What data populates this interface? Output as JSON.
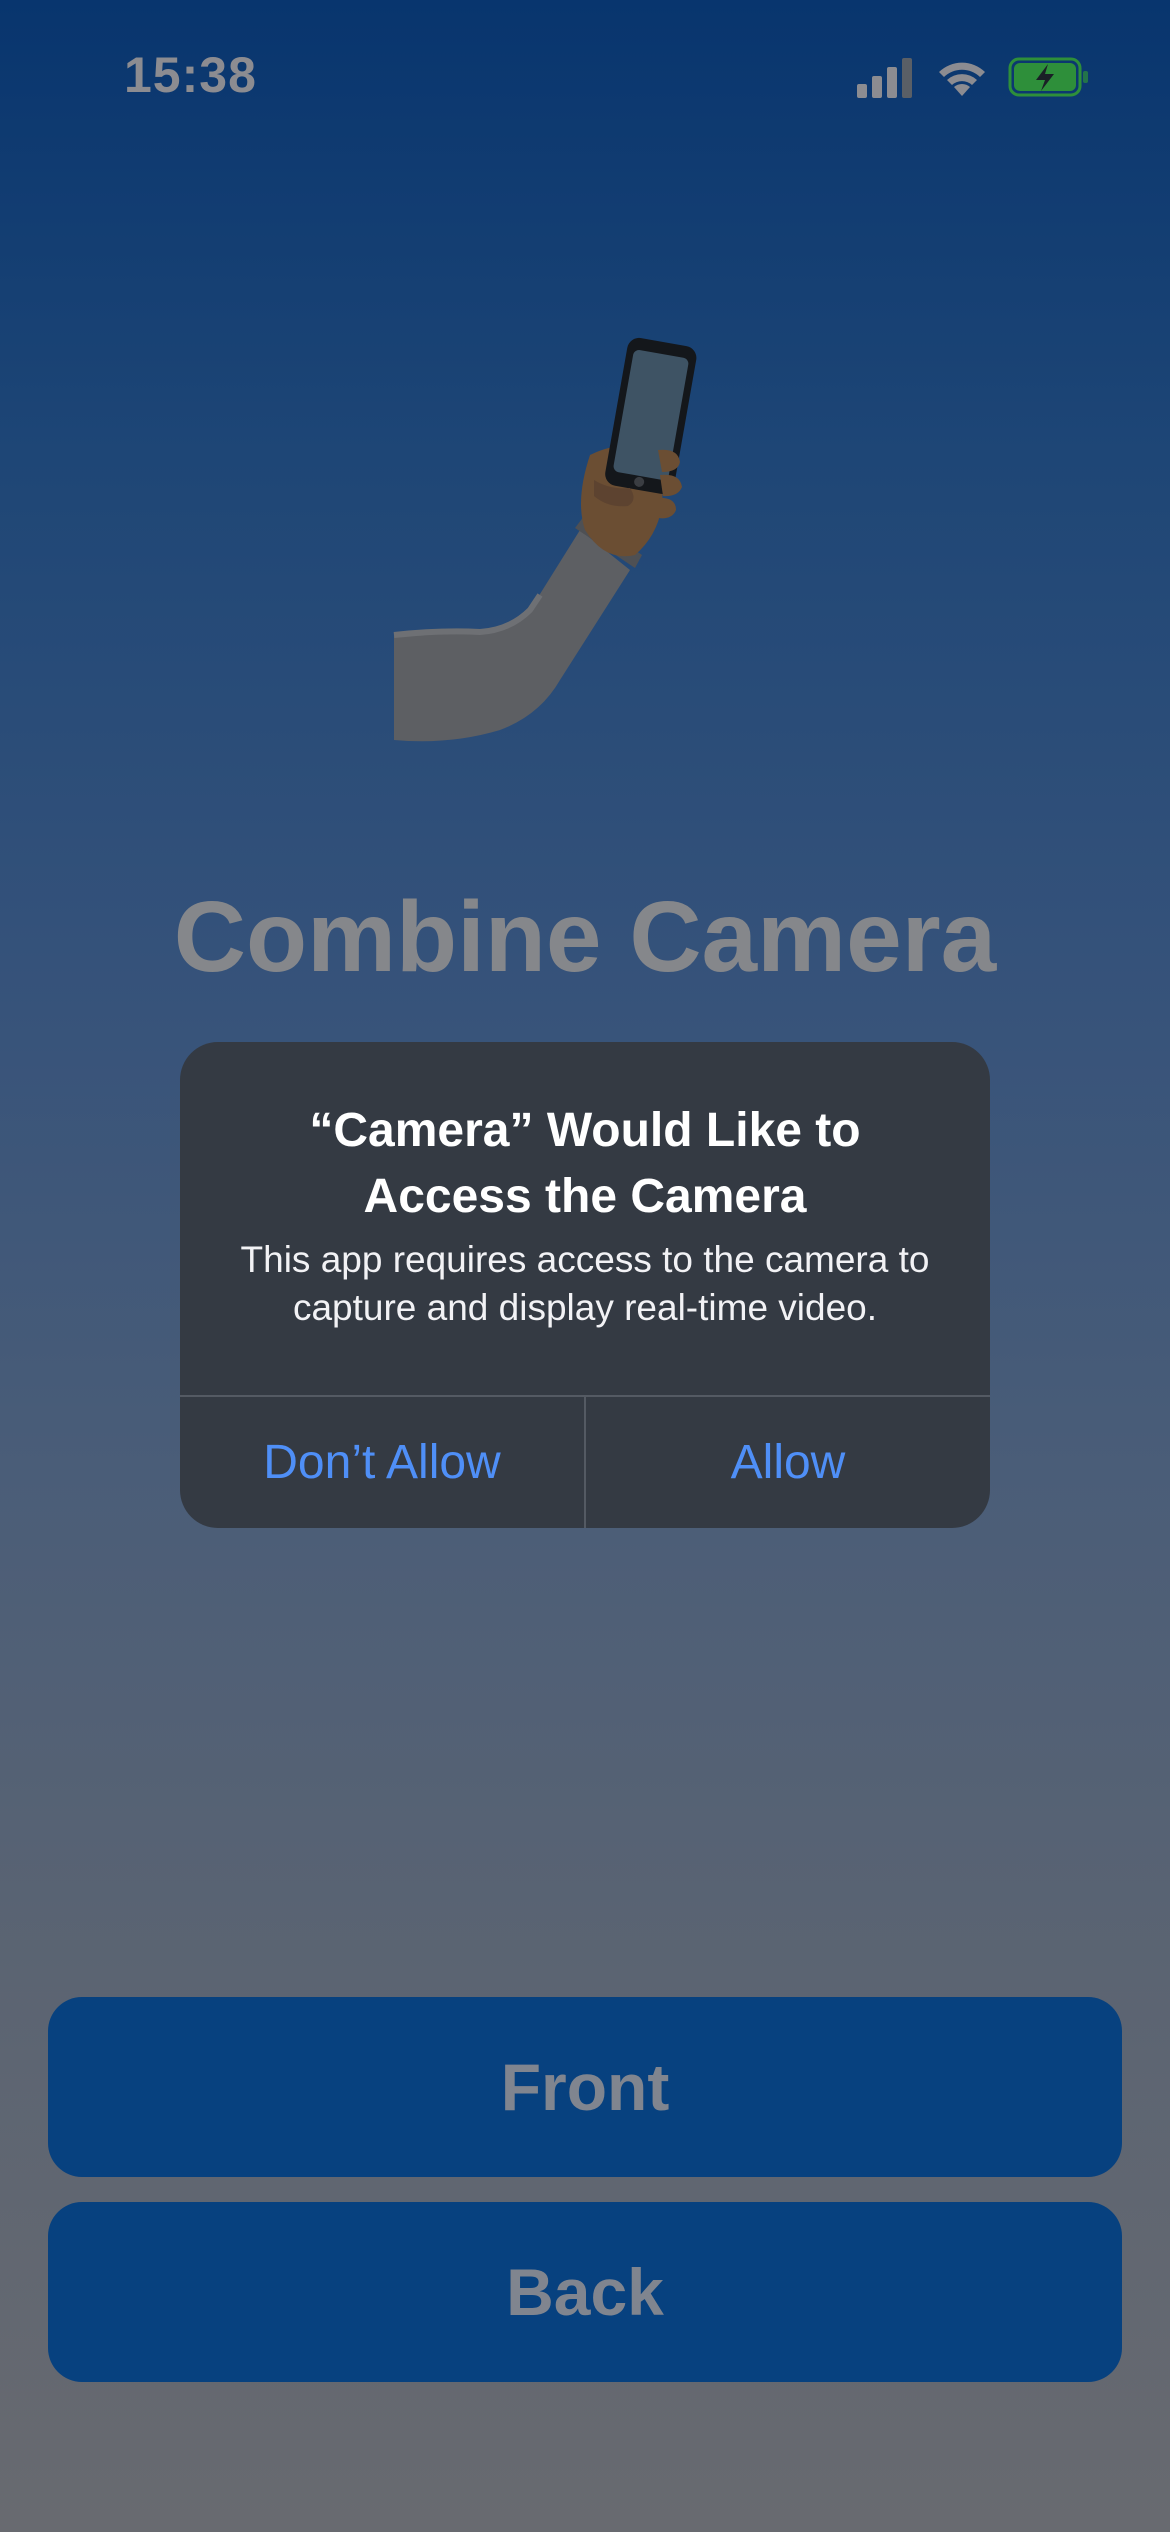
{
  "status_bar": {
    "time": "15:38",
    "icons": [
      "cellular-signal-icon",
      "wifi-icon",
      "battery-charging-icon"
    ]
  },
  "app": {
    "title": "Combine Camera",
    "hero_icon": "selfie-emoji-icon",
    "buttons": {
      "front": "Front",
      "back": "Back"
    }
  },
  "alert": {
    "title": "“Camera” Would Like to Access the Camera",
    "message": "This app requires access to the camera to capture and display real-time video.",
    "deny_label": "Don’t Allow",
    "allow_label": "Allow"
  },
  "colors": {
    "button_blue": "#07417f",
    "alert_bg": "#343a43",
    "alert_action": "#4f8ff7",
    "battery_green": "#2e8f3a"
  }
}
